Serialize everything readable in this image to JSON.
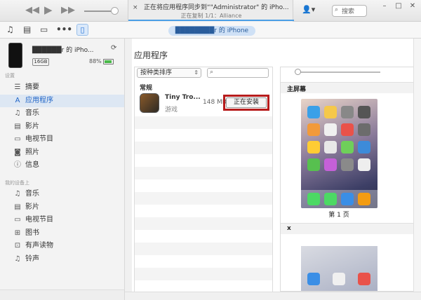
{
  "lcd": {
    "line1": "正在将应用程序同步到“\"Administrator\" 的 iPho...",
    "line2": "正在复制 1/1：Alliance",
    "close": "×"
  },
  "titlebar": {
    "account_icon": "👤▾",
    "search_icon": "⌕",
    "search_placeholder": "搜索"
  },
  "toolbar": {
    "device_name": "████████r 的 iPhone"
  },
  "device": {
    "name": "██████r 的 iPho...",
    "sync_icon": "⟳",
    "capacity": "16GB",
    "battery": "88%",
    "battery_level": 0.88,
    "battery_color": "#48b848"
  },
  "sidebar": {
    "settings_header": "设置",
    "settings": [
      {
        "label": "摘要",
        "icon": "☰"
      },
      {
        "label": "应用程序",
        "icon": "A",
        "selected": true
      },
      {
        "label": "音乐",
        "icon": "♫"
      },
      {
        "label": "影片",
        "icon": "▤"
      },
      {
        "label": "电视节目",
        "icon": "▭"
      },
      {
        "label": "照片",
        "icon": "◙"
      },
      {
        "label": "信息",
        "icon": "ⓘ"
      }
    ],
    "ondevice_header": "我的设备上",
    "ondevice": [
      {
        "label": "音乐",
        "icon": "♫"
      },
      {
        "label": "影片",
        "icon": "▤"
      },
      {
        "label": "电视节目",
        "icon": "▭"
      },
      {
        "label": "图书",
        "icon": "⊞"
      },
      {
        "label": "有声读物",
        "icon": "⊡"
      },
      {
        "label": "铃声",
        "icon": "♫"
      }
    ]
  },
  "main": {
    "title": "应用程序",
    "sort_label": "按种类排序",
    "app_search_icon": "⌕",
    "group": "常规",
    "app": {
      "name": "Tiny Tro...",
      "category": "游戏",
      "size": "148 MB",
      "install_label": "正在安装"
    },
    "home_screen_label": "主屏幕",
    "page_label": "第 1 页",
    "second_section_label": "x",
    "accent_color": "#2065c7",
    "highlight_color": "#b71c1c"
  }
}
